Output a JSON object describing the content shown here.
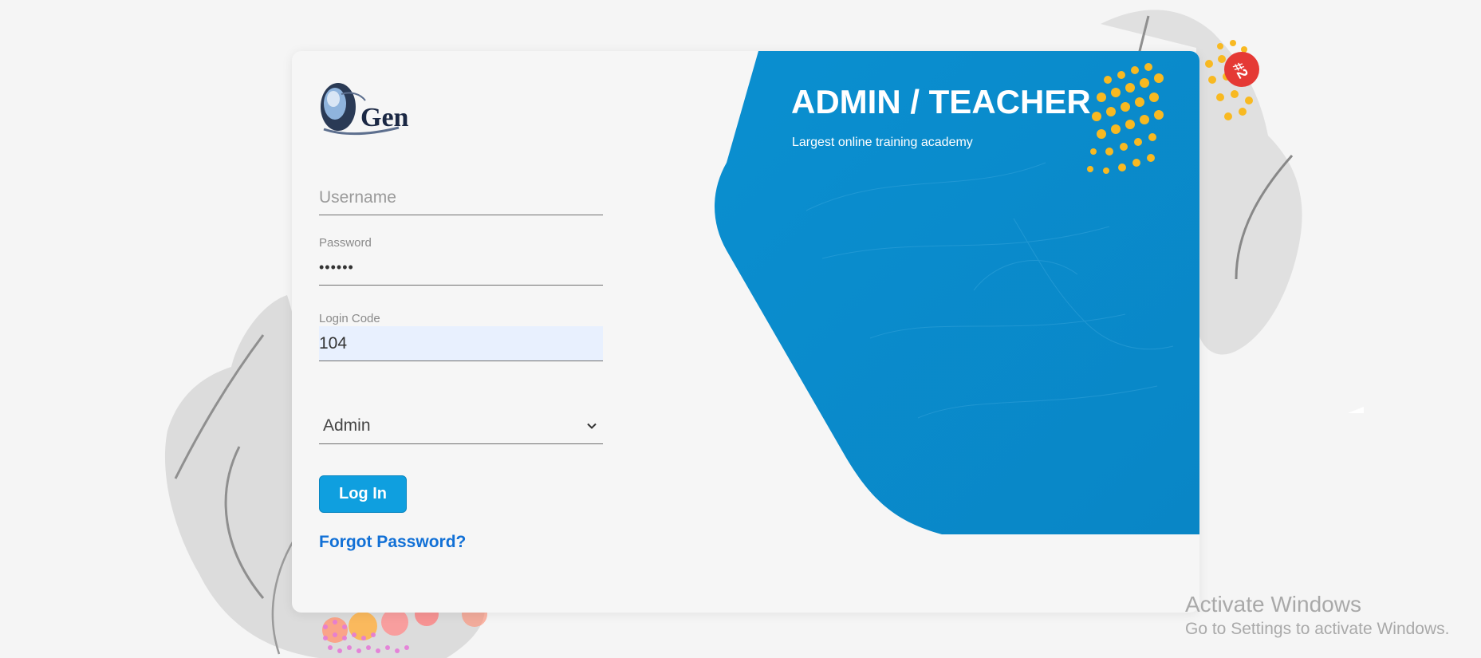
{
  "login_form": {
    "username_placeholder": "Username",
    "password_label": "Password",
    "password_value": "••••••",
    "login_code_label": "Login Code",
    "login_code_value": "104",
    "role_selected": "Admin",
    "login_button_label": "Log In",
    "forgot_password_label": "Forgot Password?"
  },
  "hero": {
    "title": "ADMIN / TEACHER",
    "subtitle": "Largest online training academy"
  },
  "watermark": {
    "title": "Activate Windows",
    "subtitle": "Go to Settings to activate Windows."
  },
  "colors": {
    "accent_blue": "#0f9fdf",
    "link_blue": "#1170d6",
    "hero_blue": "#0b8fcf",
    "autofill_bg": "#e8f0fe"
  },
  "icons": {
    "logo": "egen-logo",
    "select_chevron": "chevron-down-icon"
  }
}
